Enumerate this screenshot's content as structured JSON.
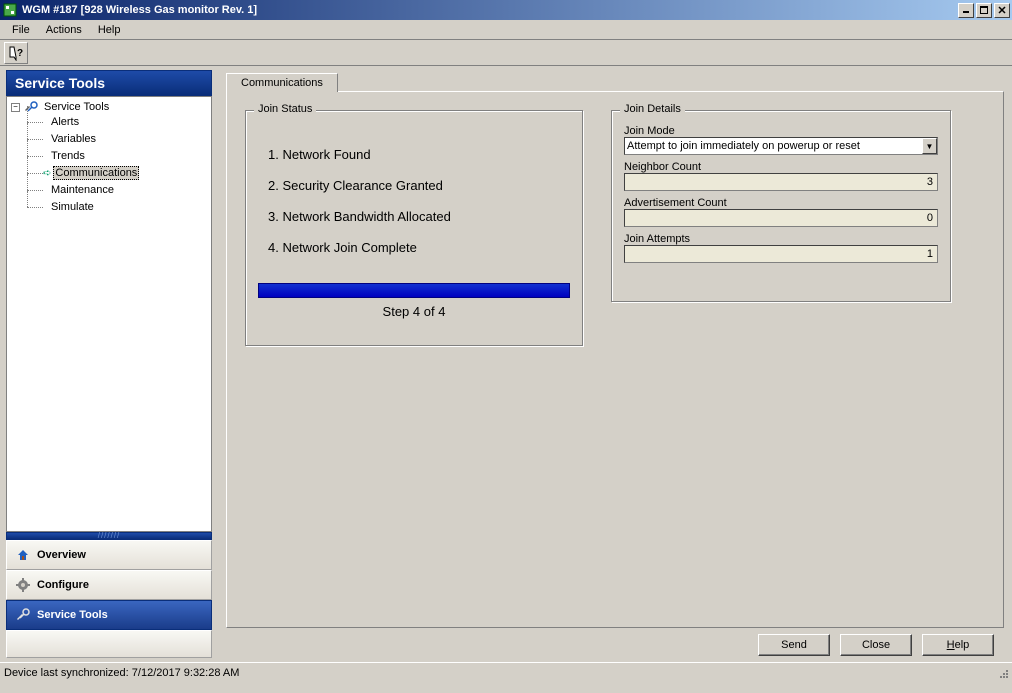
{
  "window": {
    "title": "WGM #187 [928 Wireless Gas monitor Rev. 1]"
  },
  "menubar": {
    "file": "File",
    "actions": "Actions",
    "help": "Help"
  },
  "sidebar": {
    "header": "Service Tools",
    "root": "Service Tools",
    "items": [
      "Alerts",
      "Variables",
      "Trends",
      "Communications",
      "Maintenance",
      "Simulate"
    ],
    "nav": {
      "overview": "Overview",
      "configure": "Configure",
      "service_tools": "Service Tools"
    }
  },
  "tabs": {
    "communications": "Communications"
  },
  "join_status": {
    "legend": "Join Status",
    "steps": [
      "1.  Network Found",
      "2.  Security Clearance Granted",
      "3.  Network Bandwidth Allocated",
      "4.  Network Join Complete"
    ],
    "progress_label": "Step 4 of 4"
  },
  "join_details": {
    "legend": "Join Details",
    "mode_label": "Join Mode",
    "mode_value": "Attempt to join immediately on powerup or reset",
    "neighbor_label": "Neighbor Count",
    "neighbor_value": "3",
    "ad_label": "Advertisement Count",
    "ad_value": "0",
    "attempts_label": "Join Attempts",
    "attempts_value": "1"
  },
  "buttons": {
    "send": "Send",
    "close": "Close",
    "help": "Help"
  },
  "statusbar": {
    "text": "Device last synchronized: 7/12/2017 9:32:28 AM"
  }
}
